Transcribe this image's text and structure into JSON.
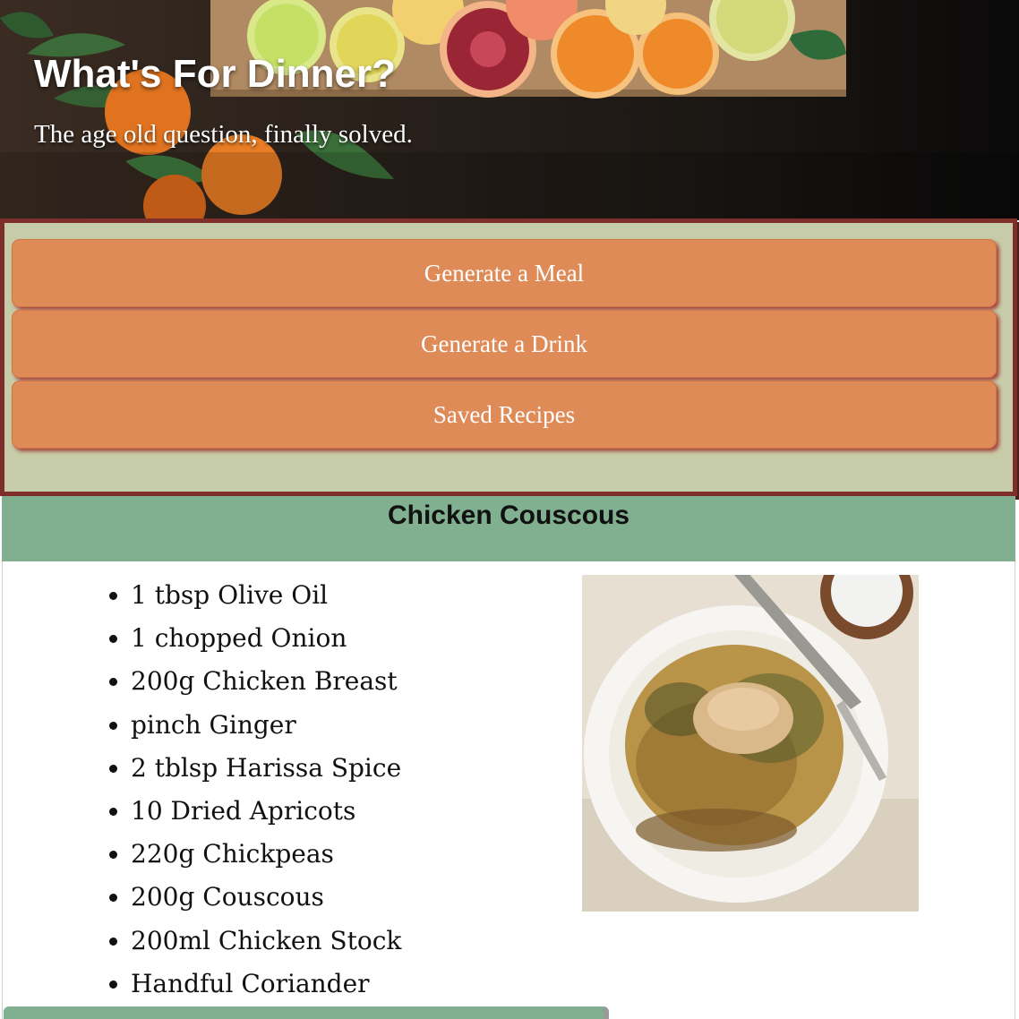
{
  "hero": {
    "title": "What's For Dinner?",
    "subtitle": "The age old question, finally solved."
  },
  "nav": {
    "buttons": [
      {
        "label": "Generate a Meal"
      },
      {
        "label": "Generate a Drink"
      },
      {
        "label": "Saved Recipes"
      }
    ]
  },
  "recipe": {
    "title": "Chicken Couscous",
    "ingredients": [
      "1 tbsp Olive Oil",
      "1 chopped Onion",
      "200g Chicken Breast",
      "pinch Ginger",
      "2 tblsp Harissa Spice",
      "10 Dried Apricots",
      "220g Chickpeas",
      "200g Couscous",
      "200ml Chicken Stock",
      "Handful Coriander"
    ]
  },
  "colors": {
    "nav_background": "#c7cca8",
    "nav_border": "#7e2f2b",
    "button": "#df8b58",
    "recipe_header": "#80b090"
  }
}
